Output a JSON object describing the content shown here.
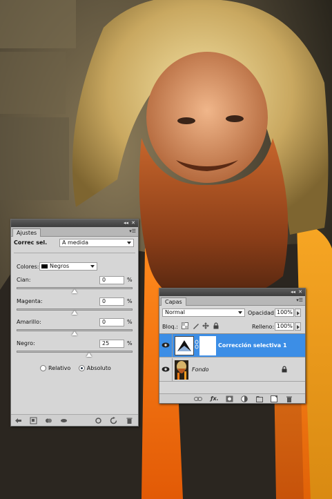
{
  "adjustments_panel": {
    "tab_label": "Ajustes",
    "adjustment_name": "Correc sel.",
    "preset": "A medida",
    "colors_label": "Colores:",
    "color_value": "Negros",
    "sliders": [
      {
        "label": "Cian:",
        "value": "0",
        "unit": "%",
        "position": 0.5
      },
      {
        "label": "Magenta:",
        "value": "0",
        "unit": "%",
        "position": 0.5
      },
      {
        "label": "Amarillo:",
        "value": "0",
        "unit": "%",
        "position": 0.5
      },
      {
        "label": "Negro:",
        "value": "25",
        "unit": "%",
        "position": 0.625
      }
    ],
    "method_options": [
      {
        "label": "Relativo",
        "selected": false
      },
      {
        "label": "Absoluto",
        "selected": true
      }
    ]
  },
  "layers_panel": {
    "tab_label": "Capas",
    "blend_mode": "Normal",
    "opacity_label": "Opacidad:",
    "opacity_value": "100%",
    "lock_label": "Bloq.:",
    "fill_label": "Relleno:",
    "fill_value": "100%",
    "layers": [
      {
        "name": "Corrección selectiva 1",
        "selected": true
      },
      {
        "name": "Fondo",
        "selected": false,
        "locked": true
      }
    ]
  },
  "colors": {
    "selection": "#3c8ee6",
    "panel_bg": "#d6d6d6"
  }
}
